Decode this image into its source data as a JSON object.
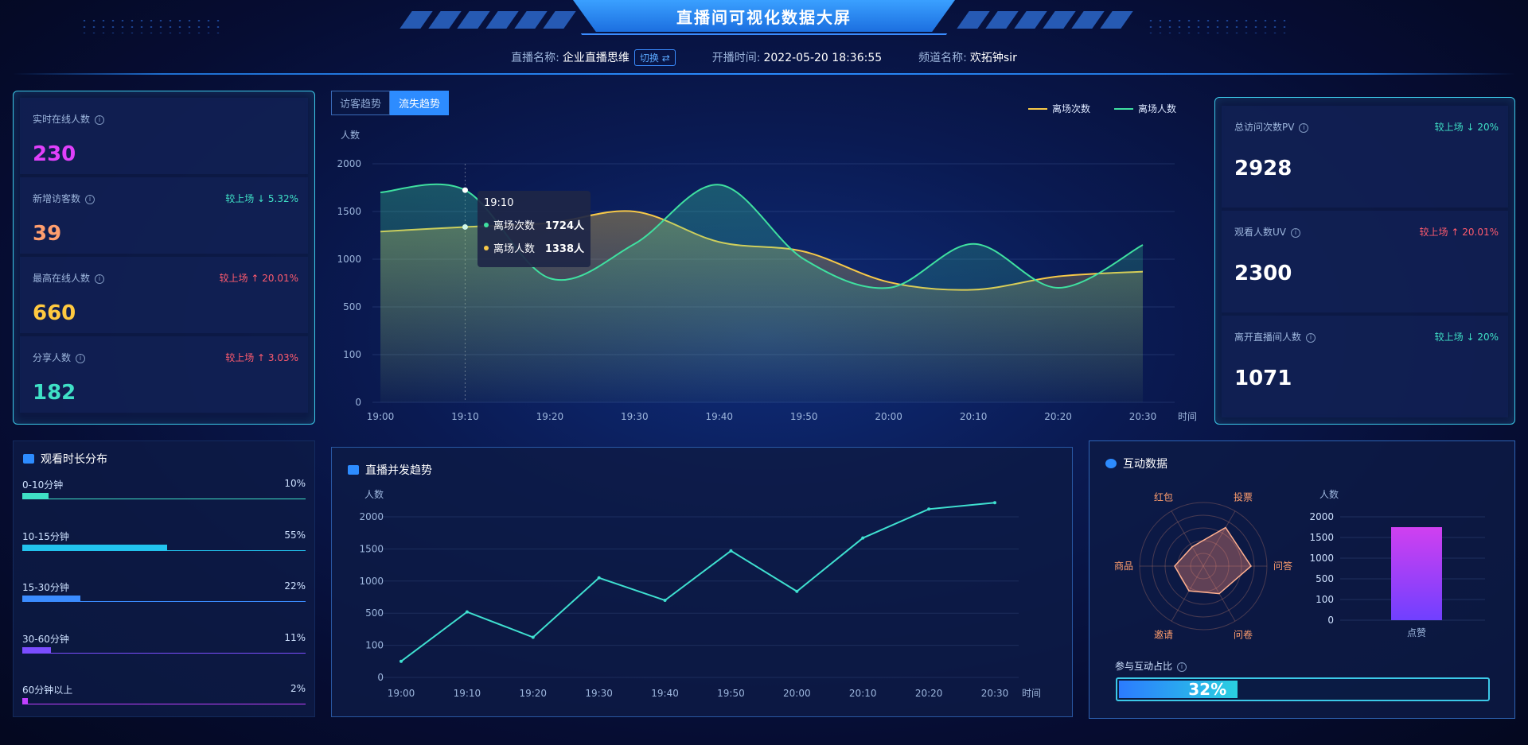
{
  "header": {
    "title": "直播间可视化数据大屏",
    "live_name_label": "直播名称:",
    "live_name": "企业直播思维",
    "switch_label": "切换 ⇄",
    "start_time_label": "开播时间:",
    "start_time": "2022-05-20 18:36:55",
    "channel_label": "频道名称:",
    "channel_name": "欢拓钟sir"
  },
  "left_stats": [
    {
      "label": "实时在线人数",
      "value": "230",
      "compare": "",
      "color": "#e040fb"
    },
    {
      "label": "新增访客数",
      "value": "39",
      "compare": "较上场 ↓ 5.32%",
      "dir": "down",
      "color": "#ff9e6e"
    },
    {
      "label": "最高在线人数",
      "value": "660",
      "compare": "较上场 ↑ 20.01%",
      "dir": "up",
      "color": "#ffc940"
    },
    {
      "label": "分享人数",
      "value": "182",
      "compare": "较上场 ↑ 3.03%",
      "dir": "up",
      "color": "#3fe0c6"
    }
  ],
  "trend": {
    "tabs": [
      "访客趋势",
      "流失趋势"
    ],
    "active_tab": 1,
    "legend": [
      {
        "name": "离场次数",
        "color": "#f7c948"
      },
      {
        "name": "离场人数",
        "color": "#3fe0a0"
      }
    ],
    "tooltip": {
      "time": "19:10",
      "rows": [
        {
          "name": "离场次数",
          "value": "1724人",
          "color": "#3fe0a0"
        },
        {
          "name": "离场人数",
          "value": "1338人",
          "color": "#f7c948"
        }
      ]
    }
  },
  "chart_data": [
    {
      "type": "area",
      "title": "",
      "ylabel": "人数",
      "xlabel": "时间",
      "x": [
        "19:00",
        "19:10",
        "19:20",
        "19:30",
        "19:40",
        "19:50",
        "20:00",
        "20:10",
        "20:20",
        "20:30"
      ],
      "y_ticks": [
        "0",
        "100",
        "500",
        "1000",
        "1500",
        "2000"
      ],
      "series": [
        {
          "name": "离场次数",
          "color": "#f7c948",
          "values": [
            1290,
            1338,
            1380,
            1500,
            1180,
            1080,
            760,
            680,
            820,
            870
          ]
        },
        {
          "name": "离场人数",
          "color": "#3fe0a0",
          "values": [
            1700,
            1724,
            800,
            1160,
            1780,
            1000,
            700,
            1160,
            700,
            1150
          ]
        }
      ]
    },
    {
      "type": "line",
      "title": "直播并发趋势",
      "ylabel": "人数",
      "xlabel": "时间",
      "x": [
        "19:00",
        "19:10",
        "19:20",
        "19:30",
        "19:40",
        "19:50",
        "20:00",
        "20:10",
        "20:20",
        "20:30"
      ],
      "y_ticks": [
        "0",
        "100",
        "500",
        "1000",
        "1500",
        "2000"
      ],
      "series": [
        {
          "name": "",
          "color": "#3fe0d0",
          "values": [
            50,
            520,
            200,
            1050,
            700,
            1470,
            840,
            1670,
            2120,
            2220
          ]
        }
      ]
    },
    {
      "type": "bar",
      "title": "",
      "ylabel": "人数",
      "categories": [
        "点赞"
      ],
      "y_ticks": [
        "0",
        "100",
        "500",
        "1000",
        "1500",
        "2000"
      ],
      "values": [
        1750
      ]
    }
  ],
  "right_stats": [
    {
      "label": "总访问次数PV",
      "value": "2928",
      "compare": "较上场 ↓ 20%",
      "dir": "down"
    },
    {
      "label": "观看人数UV",
      "value": "2300",
      "compare": "较上场 ↑ 20.01%",
      "dir": "up"
    },
    {
      "label": "离开直播间人数",
      "value": "1071",
      "compare": "较上场 ↓ 20%",
      "dir": "down"
    }
  ],
  "duration": {
    "title": "观看时长分布",
    "items": [
      {
        "label": "0-10分钟",
        "pct": "10%",
        "value": 0.1,
        "color": "#3fe0c6"
      },
      {
        "label": "10-15分钟",
        "pct": "55%",
        "value": 0.55,
        "color": "#22c3ee"
      },
      {
        "label": "15-30分钟",
        "pct": "22%",
        "value": 0.22,
        "color": "#3b8cff"
      },
      {
        "label": "30-60分钟",
        "pct": "11%",
        "value": 0.11,
        "color": "#7b4dff"
      },
      {
        "label": "60分钟以上",
        "pct": "2%",
        "value": 0.02,
        "color": "#c040ff"
      }
    ]
  },
  "concurrency": {
    "title": "直播并发趋势"
  },
  "interaction": {
    "title": "互动数据",
    "radar_labels": [
      "投票",
      "问答",
      "问卷",
      "邀请",
      "商品",
      "红包"
    ],
    "radar_values": [
      0.7,
      0.75,
      0.5,
      0.45,
      0.45,
      0.35
    ],
    "ratio_label": "参与互动占比",
    "ratio_text": "32%",
    "ratio_value": 0.32
  }
}
